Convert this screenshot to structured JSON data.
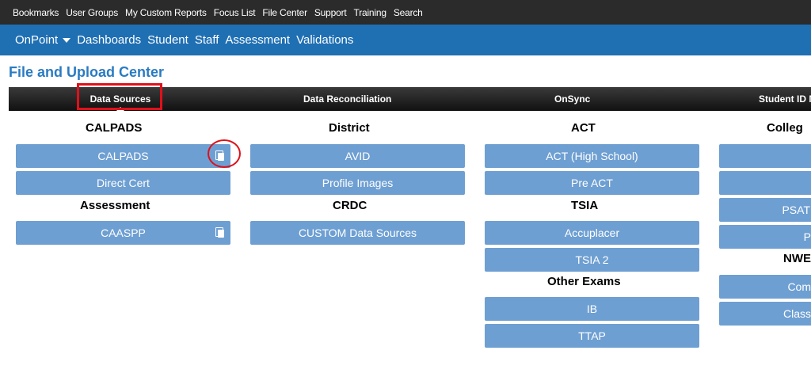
{
  "topbar": {
    "items": [
      "Bookmarks",
      "User Groups",
      "My Custom Reports",
      "Focus List",
      "File Center",
      "Support",
      "Training",
      "Search"
    ]
  },
  "navbar": {
    "brand": "OnPoint",
    "items": [
      "Dashboards",
      "Student",
      "Staff",
      "Assessment",
      "Validations"
    ]
  },
  "page": {
    "title": "File and Upload Center"
  },
  "tabs": [
    "Data Sources",
    "Data Reconciliation",
    "OnSync",
    "Student ID M"
  ],
  "columns": [
    {
      "groups": [
        {
          "heading": "CALPADS",
          "buttons": [
            "CALPADS",
            "Direct Cert"
          ]
        },
        {
          "heading": "Assessment",
          "buttons": [
            "CAASPP"
          ]
        }
      ]
    },
    {
      "groups": [
        {
          "heading": "District",
          "buttons": [
            "AVID",
            "Profile Images"
          ]
        },
        {
          "heading": "CRDC",
          "buttons": [
            "CUSTOM Data Sources"
          ]
        }
      ]
    },
    {
      "groups": [
        {
          "heading": "ACT",
          "buttons": [
            "ACT (High School)",
            "Pre ACT"
          ]
        },
        {
          "heading": "TSIA",
          "buttons": [
            "Accuplacer",
            "TSIA 2"
          ]
        },
        {
          "heading": "Other Exams",
          "buttons": [
            "IB",
            "TTAP"
          ]
        }
      ]
    },
    {
      "groups": [
        {
          "heading": "Colleg",
          "buttons": [
            "",
            "",
            "PSAT",
            "P"
          ]
        },
        {
          "heading": "NWE",
          "buttons": [
            "Com",
            "Class"
          ]
        }
      ]
    }
  ],
  "colors": {
    "topbar": "#2b2b2b",
    "navbar": "#1f6fb3",
    "title": "#2a7bc2",
    "button": "#6e9fd2",
    "annotation": "#e0101a"
  }
}
